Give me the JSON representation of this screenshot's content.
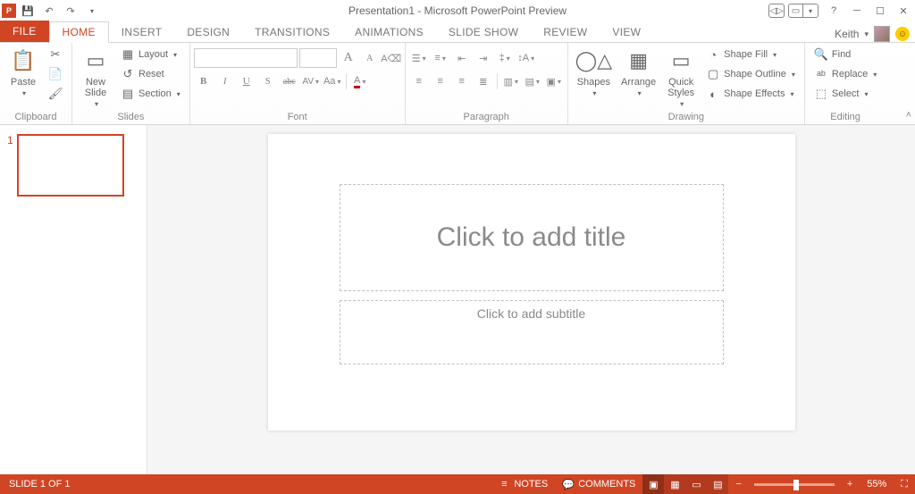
{
  "title": "Presentation1 - Microsoft PowerPoint Preview",
  "user": {
    "name": "Keith",
    "dropdown": "▾"
  },
  "tabs": {
    "file": "FILE",
    "items": [
      "HOME",
      "INSERT",
      "DESIGN",
      "TRANSITIONS",
      "ANIMATIONS",
      "SLIDE SHOW",
      "REVIEW",
      "VIEW"
    ],
    "active": 0
  },
  "ribbon": {
    "clipboard": {
      "label": "Clipboard",
      "paste": "Paste",
      "cut": "Cut",
      "copy": "Copy",
      "format_painter": "Format Painter"
    },
    "slides": {
      "label": "Slides",
      "new_slide": "New\nSlide",
      "layout": "Layout",
      "reset": "Reset",
      "section": "Section"
    },
    "font": {
      "label": "Font",
      "name": "",
      "size": "",
      "grow": "A",
      "shrink": "A",
      "clear": "A",
      "bold": "B",
      "italic": "I",
      "underline": "U",
      "shadow": "S",
      "strike": "abc",
      "spacing": "AV",
      "case": "Aa",
      "color": "A"
    },
    "paragraph": {
      "label": "Paragraph",
      "direction": "Text Direction",
      "align_text": "Align Text",
      "smartart": "Convert to SmartArt"
    },
    "drawing": {
      "label": "Drawing",
      "shapes": "Shapes",
      "arrange": "Arrange",
      "quick_styles": "Quick\nStyles",
      "shape_fill": "Shape Fill",
      "shape_outline": "Shape Outline",
      "shape_effects": "Shape Effects"
    },
    "editing": {
      "label": "Editing",
      "find": "Find",
      "replace": "Replace",
      "select": "Select"
    }
  },
  "slide": {
    "title_placeholder": "Click to add title",
    "subtitle_placeholder": "Click to add subtitle"
  },
  "thumbs": {
    "num": "1"
  },
  "status": {
    "slide_of": "SLIDE 1 OF 1",
    "notes": "NOTES",
    "comments": "COMMENTS",
    "zoom": "55%",
    "minus": "−",
    "plus": "+"
  }
}
